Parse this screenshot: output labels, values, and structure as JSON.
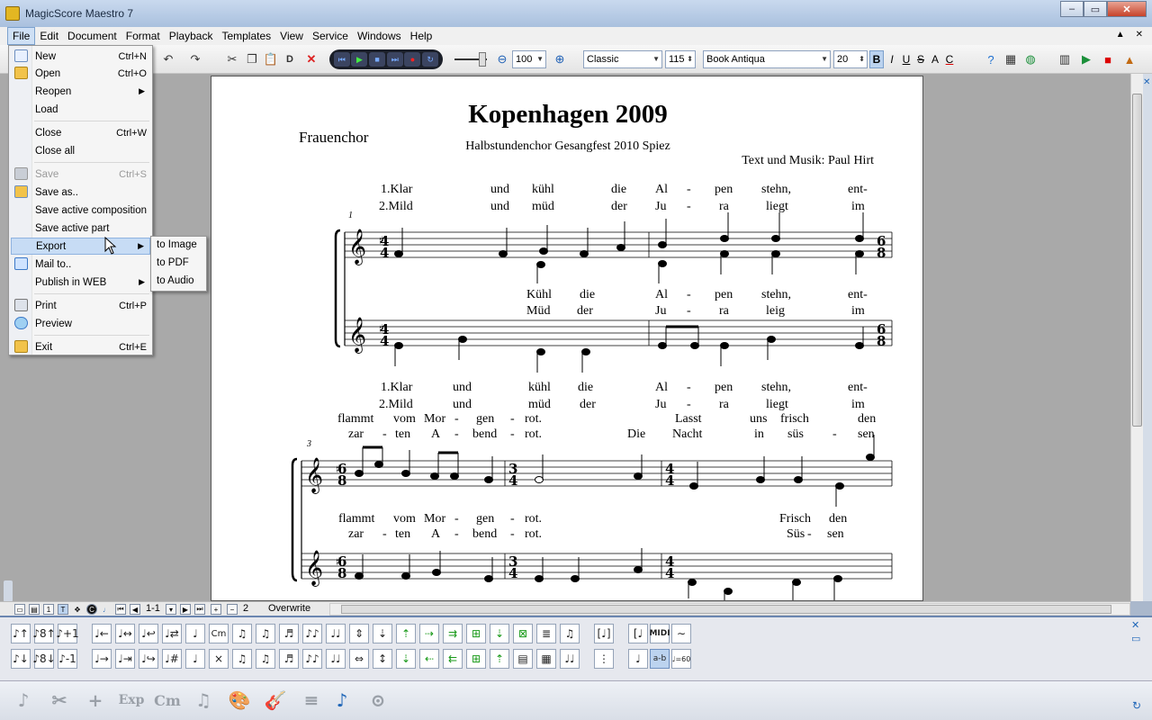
{
  "window": {
    "title": "MagicScore Maestro 7",
    "ghost_tabs": [
      "",
      "",
      "",
      "",
      "",
      "",
      "",
      "",
      "",
      ""
    ]
  },
  "menu": [
    "File",
    "Edit",
    "Document",
    "Format",
    "Playback",
    "Templates",
    "View",
    "Service",
    "Windows",
    "Help"
  ],
  "toolbar": {
    "zoom_value": "100",
    "style_value": "Classic",
    "style_size": "115",
    "font_value": "Book Antiqua",
    "font_size": "20",
    "format_buttons": [
      "B",
      "I",
      "U",
      "S",
      "A",
      "C"
    ]
  },
  "file_menu": {
    "items": [
      {
        "label": "New",
        "shortcut": "Ctrl+N",
        "icon": "new-file-icon",
        "disabled": false
      },
      {
        "label": "Open",
        "shortcut": "Ctrl+O",
        "icon": "open-folder-icon",
        "disabled": false
      },
      {
        "label": "Reopen",
        "shortcut": "",
        "icon": "",
        "disabled": false,
        "submenu": true
      },
      {
        "label": "Load",
        "shortcut": "",
        "icon": "",
        "disabled": false
      },
      {
        "label": "Close",
        "shortcut": "Ctrl+W",
        "icon": "",
        "disabled": false
      },
      {
        "label": "Close all",
        "shortcut": "",
        "icon": "",
        "disabled": false
      },
      {
        "label": "Save",
        "shortcut": "Ctrl+S",
        "icon": "save-icon",
        "disabled": true
      },
      {
        "label": "Save as..",
        "shortcut": "",
        "icon": "save-as-icon",
        "disabled": false
      },
      {
        "label": "Save active composition",
        "shortcut": "",
        "icon": "",
        "disabled": false
      },
      {
        "label": "Save active part",
        "shortcut": "",
        "icon": "",
        "disabled": false
      },
      {
        "label": "Export",
        "shortcut": "",
        "icon": "",
        "disabled": false,
        "submenu": true,
        "hover": true
      },
      {
        "label": "Mail to..",
        "shortcut": "",
        "icon": "mail-icon",
        "disabled": false
      },
      {
        "label": "Publish in WEB",
        "shortcut": "",
        "icon": "",
        "disabled": false,
        "submenu": true
      },
      {
        "label": "Print",
        "shortcut": "Ctrl+P",
        "icon": "print-icon",
        "disabled": false
      },
      {
        "label": "Preview",
        "shortcut": "",
        "icon": "preview-icon",
        "disabled": false
      },
      {
        "label": "Exit",
        "shortcut": "Ctrl+E",
        "icon": "exit-icon",
        "disabled": false
      }
    ],
    "export_submenu": [
      "to Image",
      "to PDF",
      "to Audio"
    ]
  },
  "score": {
    "title": "Kopenhagen 2009",
    "subtitle": "Halbstundenchor Gesangfest 2010  Spiez",
    "left_label": "Frauenchor",
    "composer": "Text und Musik: Paul Hirt",
    "measure_numbers": [
      "1",
      "3"
    ],
    "lyrics": {
      "sys1_top_v1": [
        "1.Klar",
        "und",
        "kühl",
        "die",
        "Al",
        "-",
        "pen",
        "stehn,",
        "ent-"
      ],
      "sys1_top_v2": [
        "2.Mild",
        "und",
        "müd",
        "der",
        "Ju",
        "-",
        "ra",
        "liegt",
        "im"
      ],
      "sys1_mid_v1": [
        "Kühl",
        "die",
        "Al",
        "-",
        "pen",
        "stehn,",
        "ent-"
      ],
      "sys1_mid_v2": [
        "Müd",
        "der",
        "Ju",
        "-",
        "ra",
        "leig",
        "im"
      ],
      "sys1_bot_v1": [
        "1.Klar",
        "und",
        "kühl",
        "die",
        "Al",
        "-",
        "pen",
        "stehn,",
        "ent-"
      ],
      "sys1_bot_v2": [
        "2.Mild",
        "und",
        "müd",
        "der",
        "Ju",
        "-",
        "ra",
        "liegt",
        "im"
      ],
      "sys2_top_v1": [
        "flammt",
        "vom",
        "Mor",
        "-",
        "gen",
        "-",
        "rot.",
        "Lasst",
        "uns",
        "frisch",
        "den"
      ],
      "sys2_top_v2": [
        "zar",
        "-",
        "ten",
        "A",
        "-",
        "bend",
        "-",
        "rot.",
        "Die",
        "Nacht",
        "in",
        "süs",
        "-",
        "sen"
      ],
      "sys2_bot_v1": [
        "flammt",
        "vom",
        "Mor",
        "-",
        "gen",
        "-",
        "rot.",
        "Frisch",
        "den"
      ],
      "sys2_bot_v2": [
        "zar",
        "-",
        "ten",
        "A",
        "-",
        "bend",
        "-",
        "rot.",
        "Süs",
        "-",
        "sen"
      ]
    }
  },
  "status": {
    "position": "1-1",
    "parts": "2",
    "mode": "Overwrite"
  },
  "palette": {
    "row1": [
      "♪↑",
      "♪8↑",
      "♪+1",
      "♩←",
      "♩↔",
      "♩↩",
      "♩⇄",
      "♩",
      "Cm",
      "♫",
      "♫",
      "♬",
      "♪♪",
      "♩♩",
      "⇕",
      "⇣"
    ],
    "row2": [
      "♪↓",
      "♪8↓",
      "♪-1",
      "♩→",
      "♩⇥",
      "♩↪",
      "♩#",
      "♩",
      "×",
      "♫",
      "♫",
      "♬",
      "♪♪",
      "♩♩",
      "⇔",
      "↕"
    ],
    "right_labels": [
      "MIDI",
      "a-b",
      "♩=60"
    ]
  },
  "tabs": [
    "♪",
    "✂",
    "+",
    "Exp",
    "Cm",
    "♫",
    "🎨",
    "🎸",
    "≡",
    "♪",
    "⊙"
  ]
}
